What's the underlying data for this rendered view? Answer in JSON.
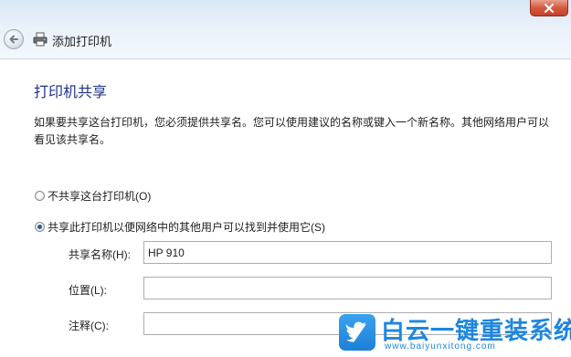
{
  "window": {
    "title": "添加打印机"
  },
  "page": {
    "title": "打印机共享",
    "description": "如果要共享这台打印机，您必须提供共享名。您可以使用建议的名称或键入一个新名称。其他网络用户可以看见该共享名。"
  },
  "options": [
    {
      "label": "不共享这台打印机(O)",
      "checked": false
    },
    {
      "label": "共享此打印机以便网络中的其他用户可以找到并使用它(S)",
      "checked": true
    }
  ],
  "fields": {
    "share_name": {
      "label": "共享名称(H):",
      "value": "HP 910"
    },
    "location": {
      "label": "位置(L):",
      "value": ""
    },
    "comment": {
      "label": "注释(C):",
      "value": ""
    }
  },
  "watermark": {
    "text": "白云一键重装系统",
    "url": "www.baiyunxitong.com"
  },
  "colors": {
    "section_title": "#1e3287",
    "watermark": "#1c86e0",
    "close_button": "#c7402a"
  }
}
